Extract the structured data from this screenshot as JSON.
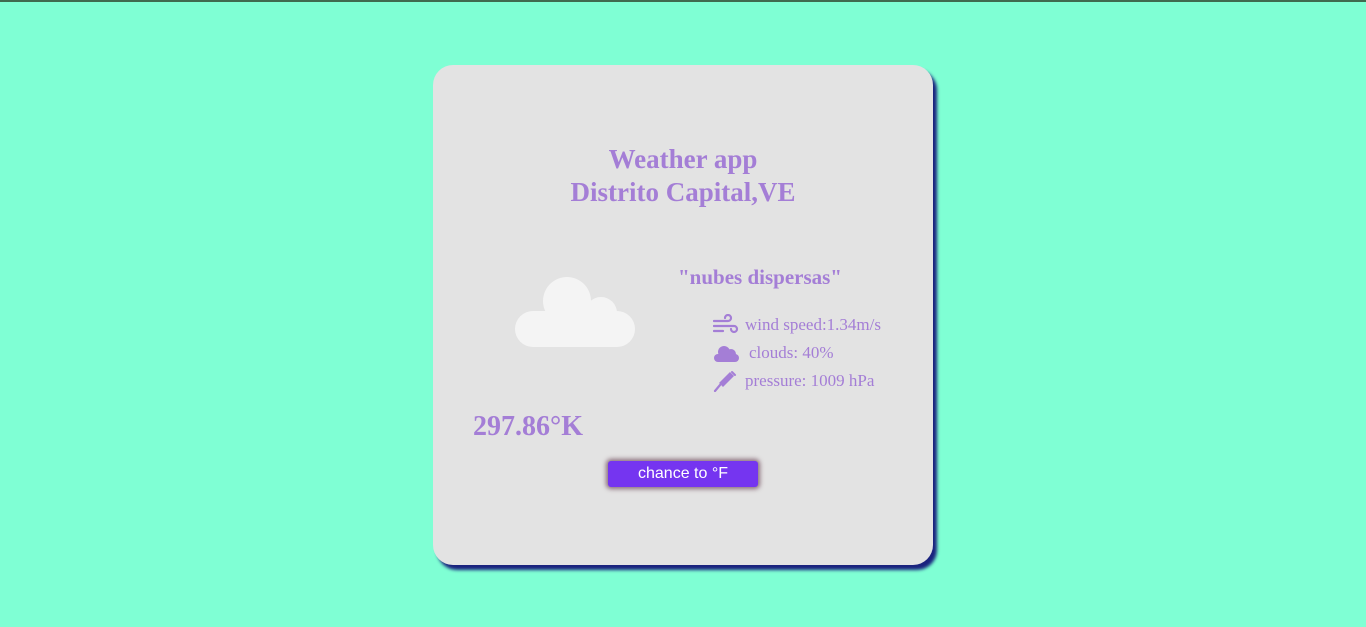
{
  "app": {
    "title": "Weather app",
    "location": "Distrito Capital,VE"
  },
  "weather": {
    "description": "\"nubes dispersas\"",
    "temperature": "297.86°K",
    "icon": "cloud-icon"
  },
  "stats": {
    "wind_label": "wind speed:1.34m/s",
    "clouds_label": "clouds: 40%",
    "pressure_label": "pressure: 1009 hPa"
  },
  "button": {
    "label": "chance to °F"
  },
  "colors": {
    "background": "#7fffd4",
    "card": "#e3e3e3",
    "text_accent": "#a47ed6",
    "button": "#7535f0",
    "card_shadow": "#1a237e"
  }
}
